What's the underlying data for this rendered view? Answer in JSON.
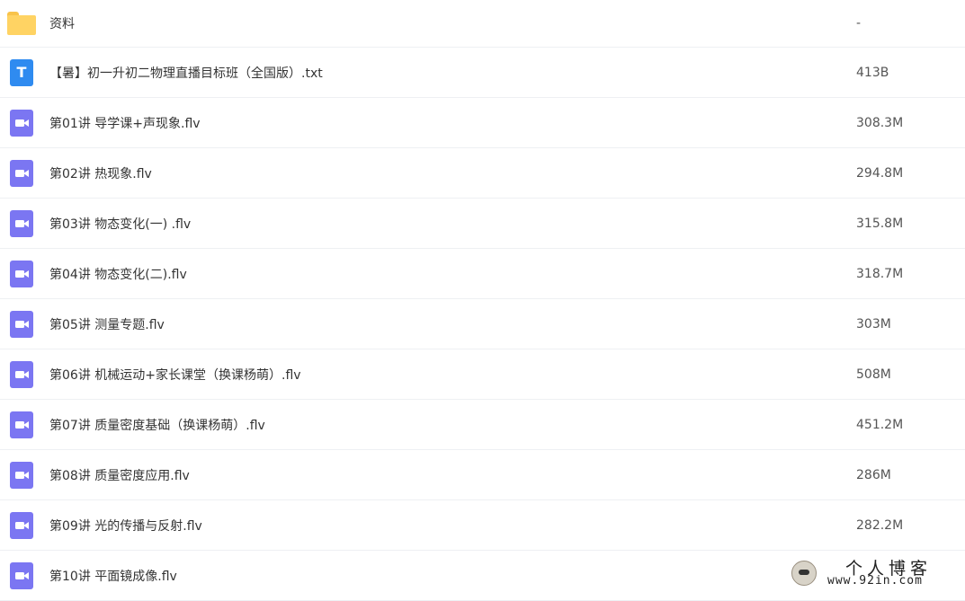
{
  "files": [
    {
      "type": "folder-icon",
      "name": "资料",
      "size": "-"
    },
    {
      "type": "txt-icon",
      "name": "【暑】初一升初二物理直播目标班（全国版）.txt",
      "size": "413B"
    },
    {
      "type": "video-icon",
      "name": "第01讲 导学课+声现象.flv",
      "size": "308.3M"
    },
    {
      "type": "video-icon",
      "name": "第02讲 热现象.flv",
      "size": "294.8M"
    },
    {
      "type": "video-icon",
      "name": "第03讲 物态变化(一) .flv",
      "size": "315.8M"
    },
    {
      "type": "video-icon",
      "name": "第04讲 物态变化(二).flv",
      "size": "318.7M"
    },
    {
      "type": "video-icon",
      "name": "第05讲 测量专题.flv",
      "size": "303M"
    },
    {
      "type": "video-icon",
      "name": "第06讲 机械运动+家长课堂（换课杨萌）.flv",
      "size": "508M"
    },
    {
      "type": "video-icon",
      "name": "第07讲 质量密度基础（换课杨萌）.flv",
      "size": "451.2M"
    },
    {
      "type": "video-icon",
      "name": "第08讲 质量密度应用.flv",
      "size": "286M"
    },
    {
      "type": "video-icon",
      "name": "第09讲 光的传播与反射.flv",
      "size": "282.2M"
    },
    {
      "type": "video-icon",
      "name": "第10讲 平面镜成像.flv",
      "size": ""
    }
  ],
  "watermark": {
    "title": "个人博客",
    "url": "www.92in.com"
  }
}
